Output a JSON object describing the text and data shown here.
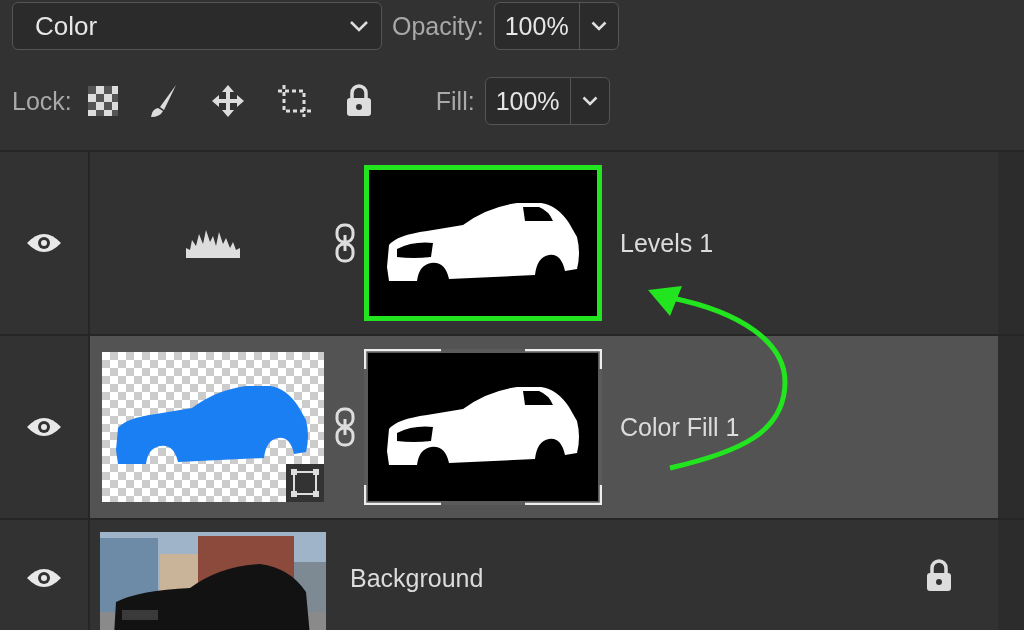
{
  "blend_mode": {
    "value": "Color"
  },
  "opacity": {
    "label": "Opacity:",
    "value": "100%"
  },
  "lock": {
    "label": "Lock:"
  },
  "fill": {
    "label": "Fill:",
    "value": "100%"
  },
  "layers": [
    {
      "name": "Levels 1",
      "kind": "adjustment",
      "selected": false,
      "visible": true,
      "mask_highlighted": true,
      "mask_selected": false,
      "locked": false
    },
    {
      "name": "Color Fill 1",
      "kind": "fill",
      "selected": true,
      "visible": true,
      "mask_highlighted": false,
      "mask_selected": true,
      "locked": false
    },
    {
      "name": "Background",
      "selected": false,
      "visible": true,
      "locked": true
    }
  ]
}
